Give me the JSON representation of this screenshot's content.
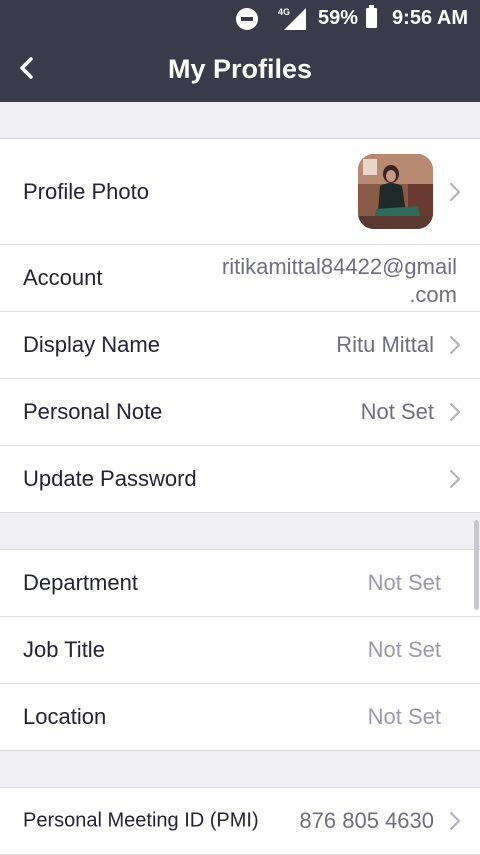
{
  "status_bar": {
    "network": "4G",
    "battery": "59%",
    "time": "9:56 AM"
  },
  "header": {
    "title": "My Profiles",
    "back_icon": "chevron-left-icon"
  },
  "groups": [
    {
      "rows": [
        {
          "label": "Profile Photo",
          "value": "",
          "chevron": true
        },
        {
          "label": "Account",
          "value_line1": "ritikamittal84422@gmail",
          "value_line2": ".com",
          "chevron": false
        },
        {
          "label": "Display Name",
          "value": "Ritu Mittal",
          "chevron": true
        },
        {
          "label": "Personal Note",
          "value": "Not Set",
          "chevron": true
        },
        {
          "label": "Update Password",
          "value": "",
          "chevron": true
        }
      ]
    },
    {
      "rows": [
        {
          "label": "Department",
          "value": "Not Set",
          "chevron": false
        },
        {
          "label": "Job Title",
          "value": "Not Set",
          "chevron": false
        },
        {
          "label": "Location",
          "value": "Not Set",
          "chevron": false
        }
      ]
    },
    {
      "rows": [
        {
          "label": "Personal Meeting ID (PMI)",
          "value": "876 805 4630",
          "chevron": true
        }
      ]
    }
  ],
  "colors": {
    "header_bg": "#3b3a4b",
    "page_bg": "#efeff4",
    "label": "#232333",
    "value": "#6e6e7e"
  }
}
